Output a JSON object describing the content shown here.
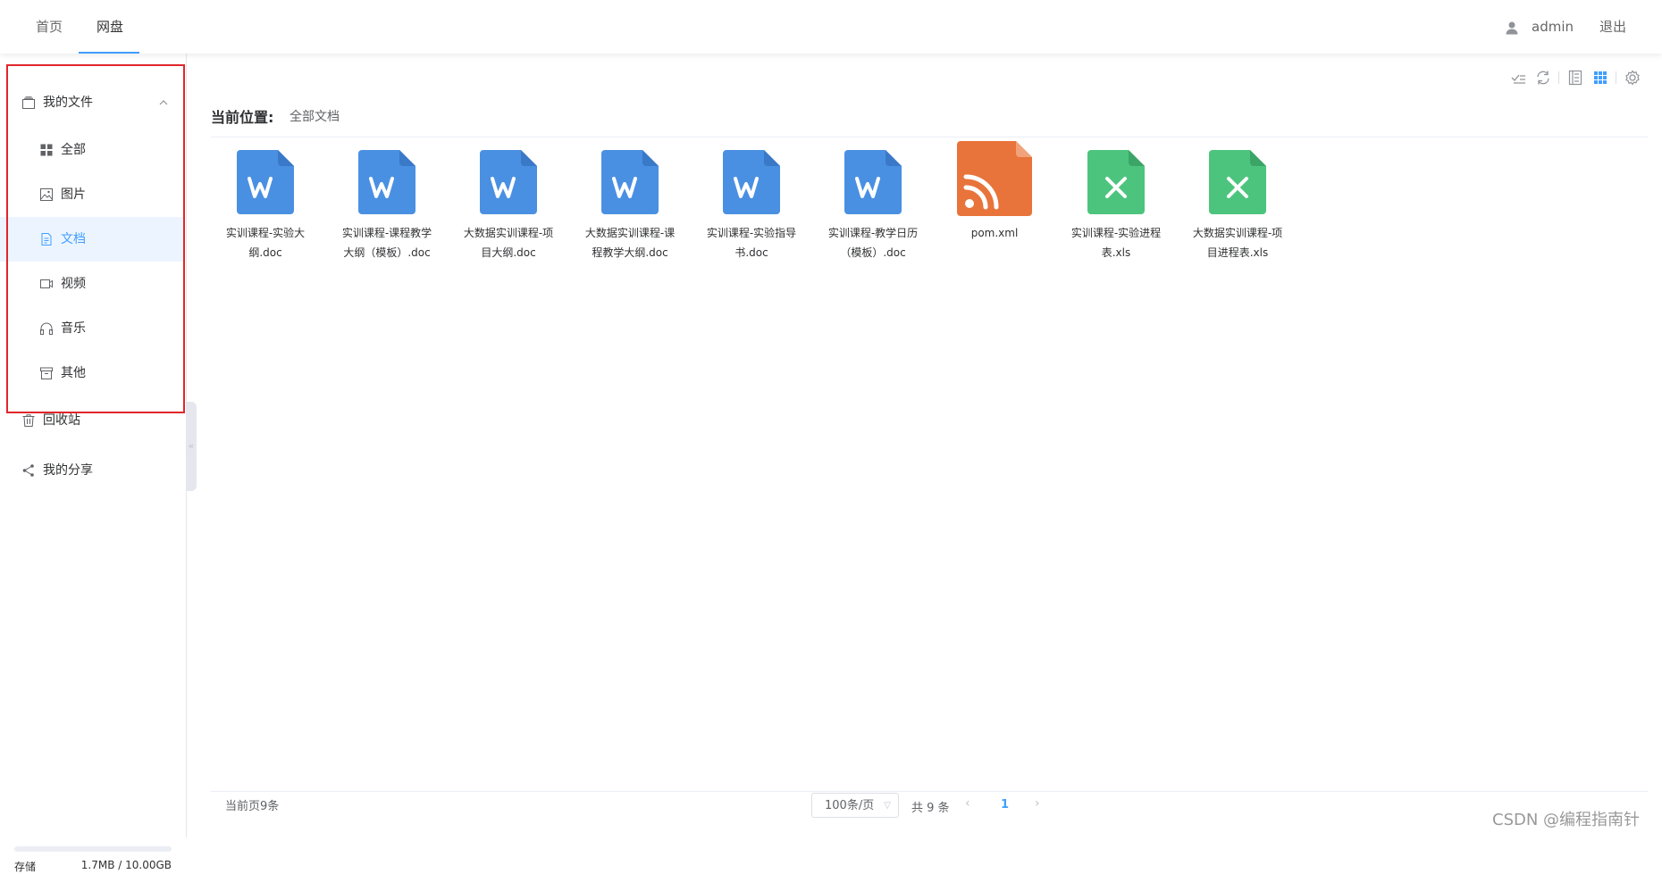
{
  "nav": {
    "tabs": [
      {
        "label": "首页"
      },
      {
        "label": "网盘"
      }
    ],
    "user": "admin",
    "logout": "退出"
  },
  "sidebar": {
    "my_files": "我的文件",
    "items": [
      {
        "label": "全部",
        "icon": "grid-icon"
      },
      {
        "label": "图片",
        "icon": "image-icon"
      },
      {
        "label": "文档",
        "icon": "document-icon"
      },
      {
        "label": "视频",
        "icon": "video-icon"
      },
      {
        "label": "音乐",
        "icon": "headphones-icon"
      },
      {
        "label": "其他",
        "icon": "archive-icon"
      }
    ],
    "recycle_bin": "回收站",
    "my_share": "我的分享",
    "storage": {
      "label": "存储",
      "value": "1.7MB / 10.00GB",
      "used_fraction": 0.00017
    }
  },
  "main": {
    "breadcrumb_label": "当前位置:",
    "breadcrumb_value": "全部文档",
    "files": [
      {
        "name": "实训课程-实验大纲.doc",
        "type": "word"
      },
      {
        "name": "实训课程-课程教学大纲（模板）.doc",
        "type": "word"
      },
      {
        "name": "大数据实训课程-项目大纲.doc",
        "type": "word"
      },
      {
        "name": "大数据实训课程-课程教学大纲.doc",
        "type": "word"
      },
      {
        "name": "实训课程-实验指导书.doc",
        "type": "word"
      },
      {
        "name": "实训课程-教学日历（模板）.doc",
        "type": "word"
      },
      {
        "name": "pom.xml",
        "type": "xml"
      },
      {
        "name": "实训课程-实验进程表.xls",
        "type": "excel"
      },
      {
        "name": "大数据实训课程-项目进程表.xls",
        "type": "excel"
      }
    ]
  },
  "pagination": {
    "current_page_count": "当前页9条",
    "page_size": "100条/页",
    "total": "共 9 条",
    "current_page": "1"
  },
  "watermark": "CSDN @编程指南针",
  "colors": {
    "accent": "#409eff",
    "word": "#4a90e2",
    "excel": "#4dc47d",
    "xml": "#e8743b",
    "highlight_box": "#e0262b"
  }
}
